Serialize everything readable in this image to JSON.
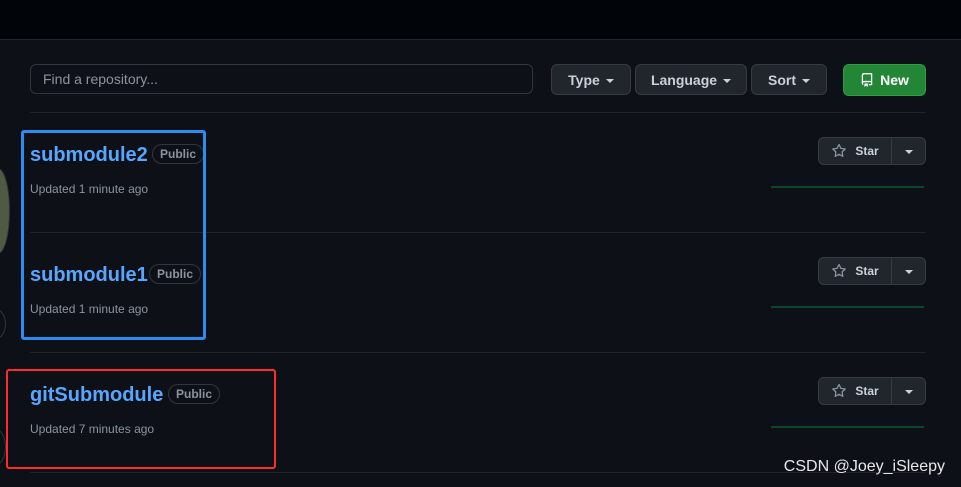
{
  "search": {
    "placeholder": "Find a repository..."
  },
  "filters": {
    "type_label": "Type",
    "language_label": "Language",
    "sort_label": "Sort"
  },
  "new_button": {
    "label": "New"
  },
  "repos": [
    {
      "name": "submodule2",
      "visibility": "Public",
      "updated": "Updated 1 minute ago",
      "star_label": "Star"
    },
    {
      "name": "submodule1",
      "visibility": "Public",
      "updated": "Updated 1 minute ago",
      "star_label": "Star"
    },
    {
      "name": "gitSubmodule",
      "visibility": "Public",
      "updated": "Updated 7 minutes ago",
      "star_label": "Star"
    }
  ],
  "watermark": "CSDN @Joey_iSleepy",
  "colors": {
    "background": "#0d1117",
    "link": "#58a6ff",
    "primary_button": "#238636",
    "highlight_blue": "#2d8cf0",
    "highlight_red": "#ff2b2b"
  },
  "icons": {
    "new": "repo-icon",
    "star": "star-icon",
    "dropdown": "triangle-down-icon"
  }
}
